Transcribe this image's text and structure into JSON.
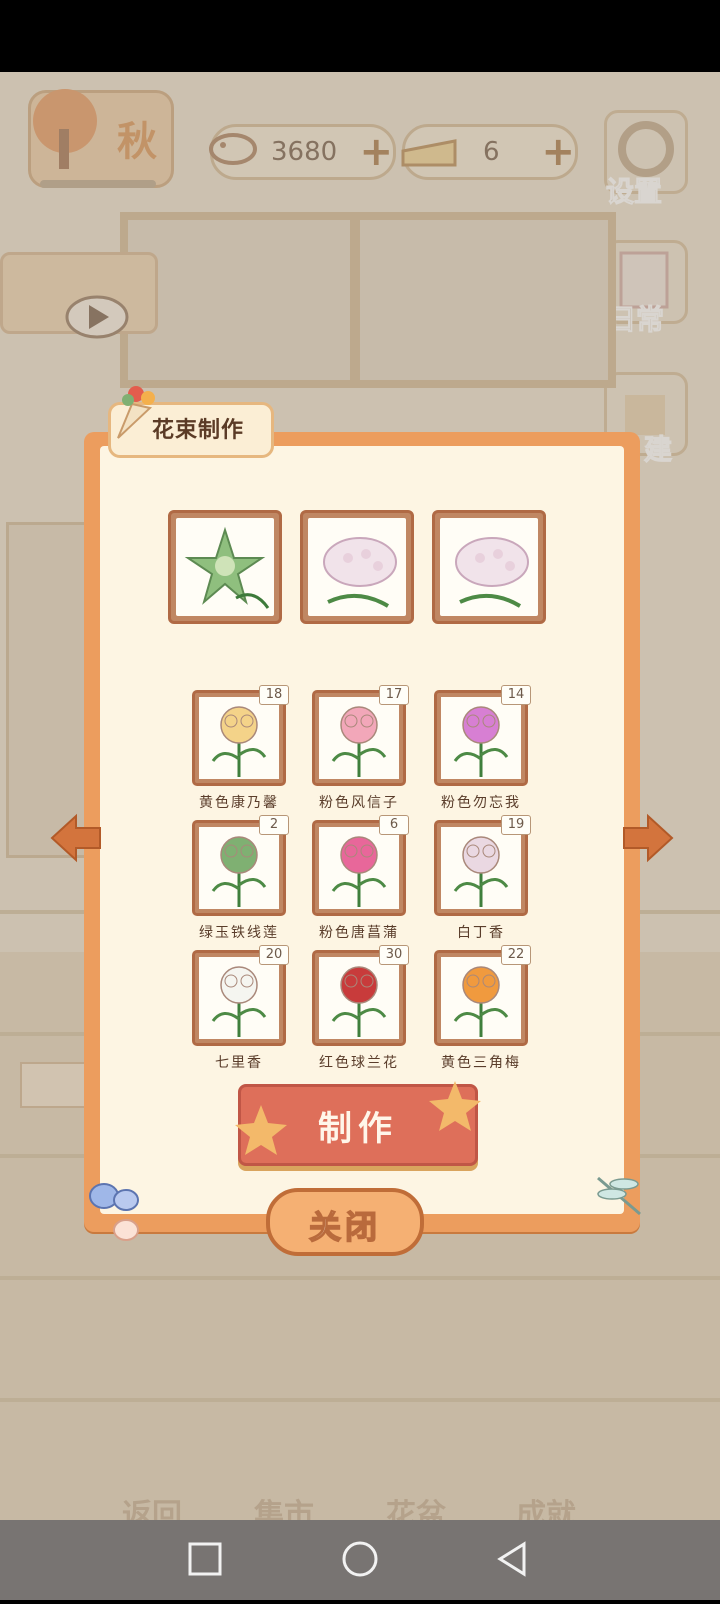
{
  "hud": {
    "season_label": "秋",
    "fish_count": "3680",
    "cheese_count": "6",
    "settings_label": "设置",
    "daily_label": "日常",
    "build_label": "建"
  },
  "panel": {
    "title": "花束制作",
    "selected_slots": [
      {
        "flower": "绿玉铁线莲"
      },
      {
        "flower": "白丁香"
      },
      {
        "flower": "白丁香"
      }
    ],
    "flowers": [
      {
        "name": "黄色康乃馨",
        "count": "18",
        "color": "#f4d389"
      },
      {
        "name": "粉色风信子",
        "count": "17",
        "color": "#f2a7b9"
      },
      {
        "name": "粉色勿忘我",
        "count": "14",
        "color": "#d77fd3"
      },
      {
        "name": "绿玉铁线莲",
        "count": "2",
        "color": "#7fb072"
      },
      {
        "name": "粉色唐菖蒲",
        "count": "6",
        "color": "#e8679a"
      },
      {
        "name": "白丁香",
        "count": "19",
        "color": "#ead8e2"
      },
      {
        "name": "七里香",
        "count": "20",
        "color": "#f5f5f0"
      },
      {
        "name": "红色球兰花",
        "count": "30",
        "color": "#c83b3b"
      },
      {
        "name": "黄色三角梅",
        "count": "22",
        "color": "#f09a3e"
      }
    ],
    "make_label": "制作",
    "close_label": "关闭"
  },
  "bottom_nav": [
    "返回",
    "集市",
    "花盆",
    "成就"
  ]
}
